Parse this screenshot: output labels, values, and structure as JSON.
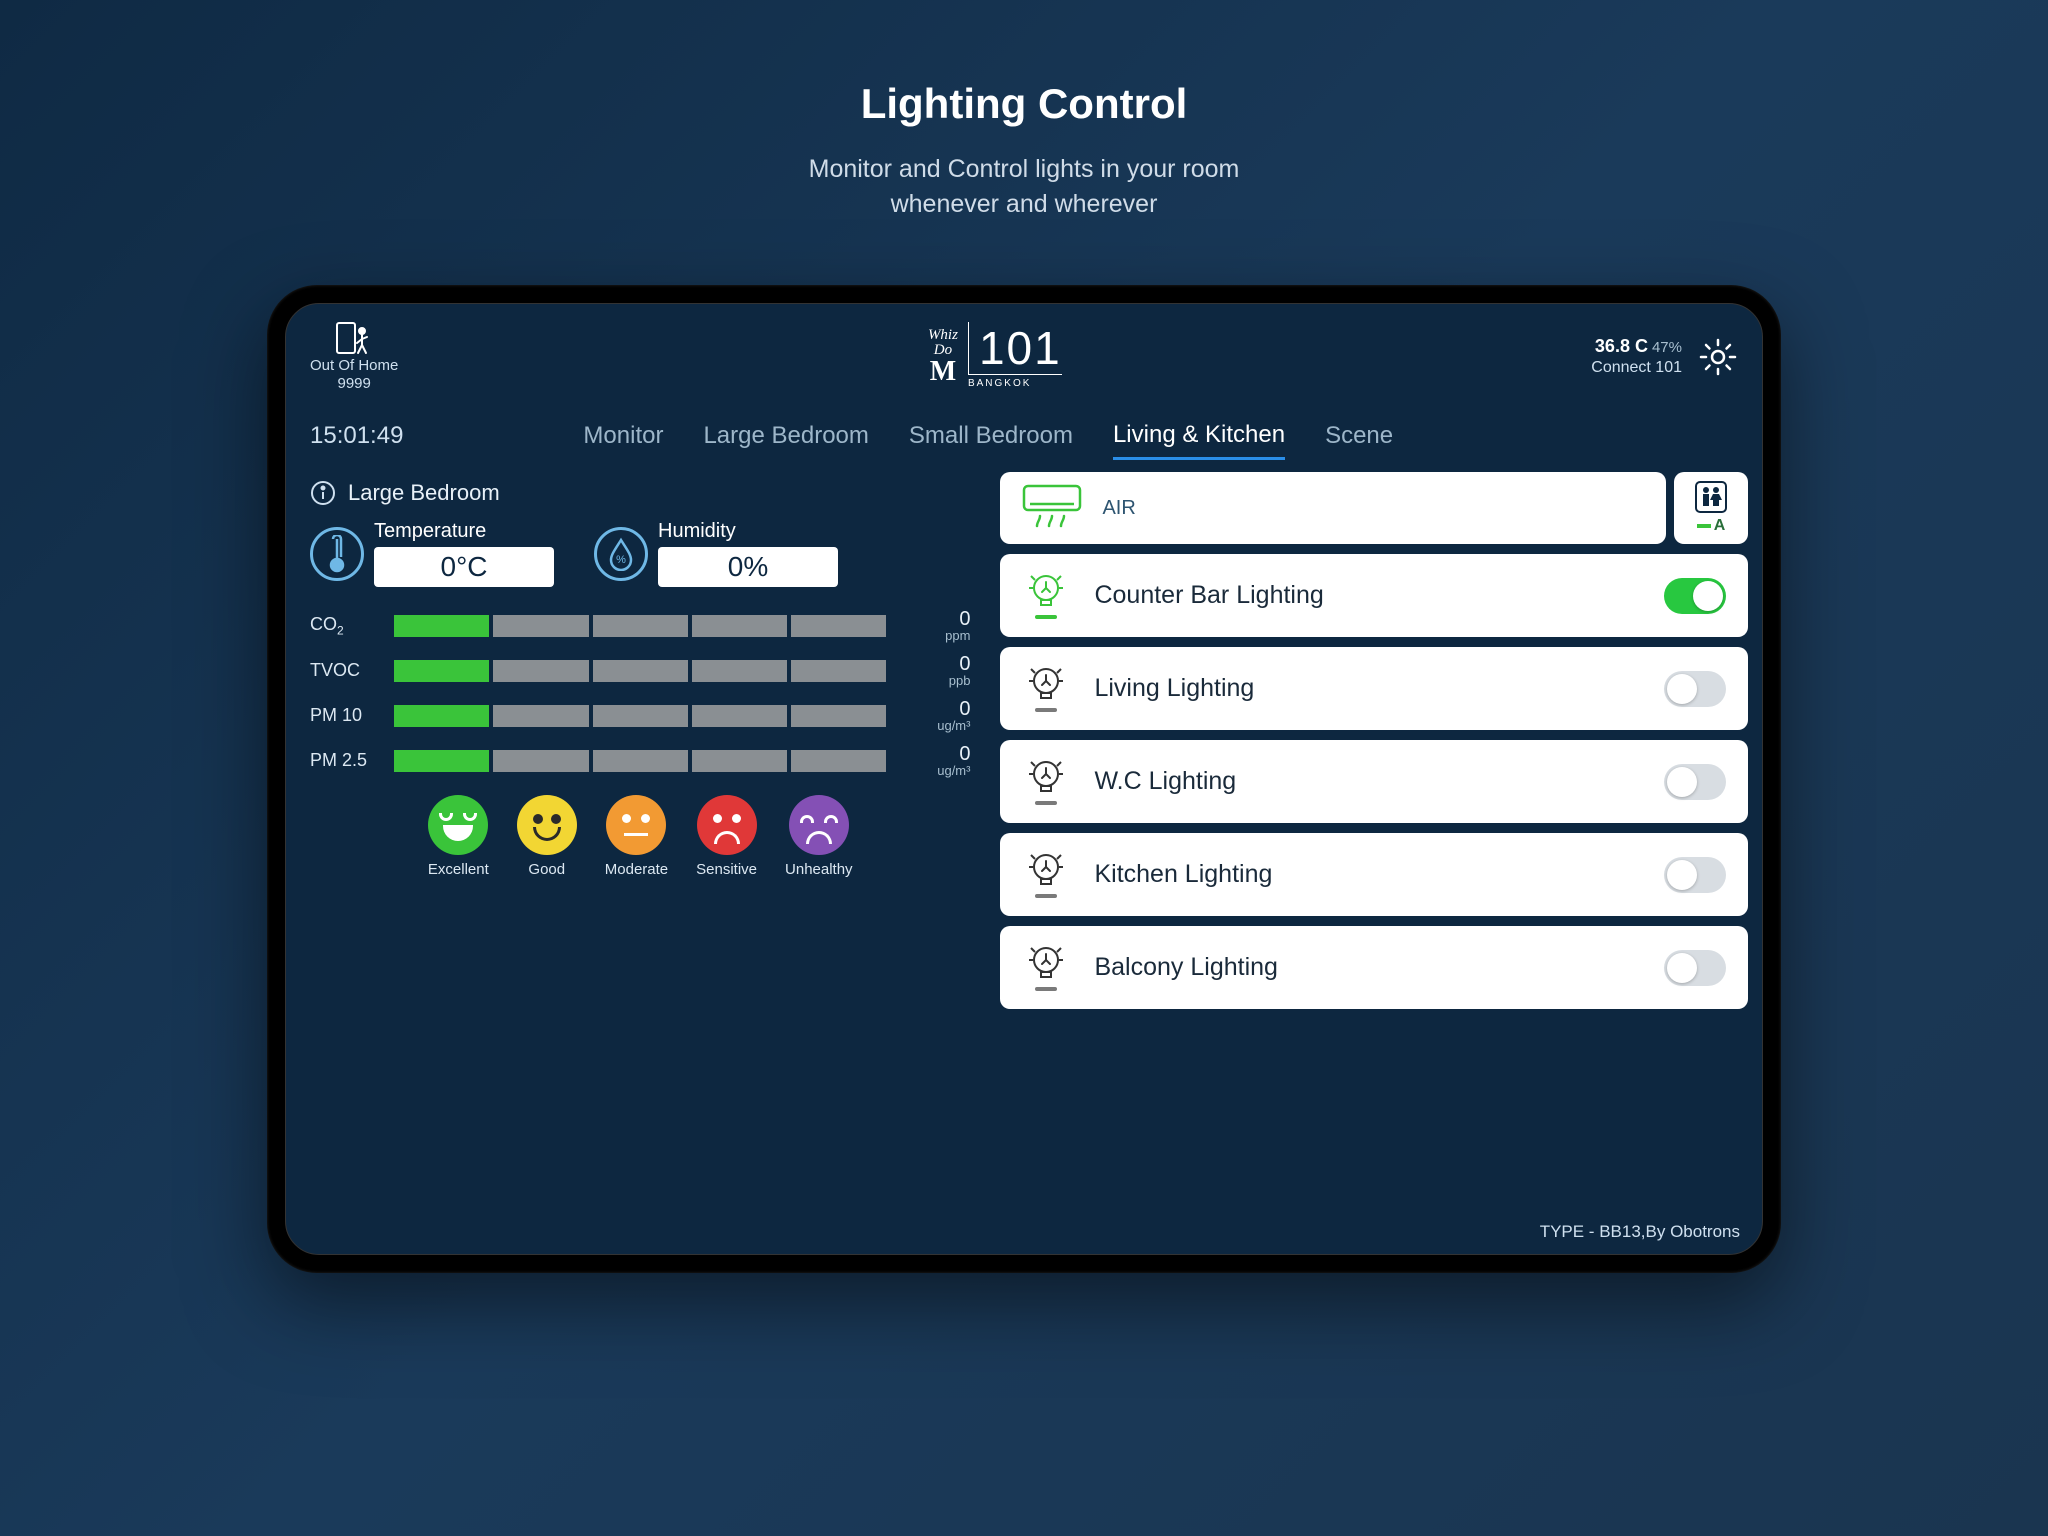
{
  "page": {
    "title": "Lighting Control",
    "subtitle_line1": "Monitor and Control lights in your room",
    "subtitle_line2": "whenever and wherever"
  },
  "header": {
    "home_label": "Out Of Home",
    "home_code": "9999",
    "brand_top": "Whiz",
    "brand_mid": "Do",
    "brand_big": "M",
    "brand_num": "101",
    "brand_sub": "BANGKOK",
    "temp": "36.8 C",
    "battery": "47%",
    "connection": "Connect 101"
  },
  "nav": {
    "clock": "15:01:49",
    "tabs": [
      "Monitor",
      "Large Bedroom",
      "Small Bedroom",
      "Living & Kitchen",
      "Scene"
    ],
    "active": 3
  },
  "room": {
    "name": "Large Bedroom",
    "temperature_label": "Temperature",
    "temperature_value": "0°C",
    "humidity_label": "Humidity",
    "humidity_value": "0%"
  },
  "quality": [
    {
      "label": "CO",
      "sub": "2",
      "value": "0",
      "unit": "ppm",
      "fill": 1
    },
    {
      "label": "TVOC",
      "sub": "",
      "value": "0",
      "unit": "ppb",
      "fill": 1
    },
    {
      "label": "PM 10",
      "sub": "",
      "value": "0",
      "unit": "ug/m³",
      "fill": 1
    },
    {
      "label": "PM 2.5",
      "sub": "",
      "value": "0",
      "unit": "ug/m³",
      "fill": 1
    }
  ],
  "legend": [
    "Excellent",
    "Good",
    "Moderate",
    "Sensitive",
    "Unhealthy"
  ],
  "air": {
    "label": "AIR",
    "mode": "A"
  },
  "lights": [
    {
      "name": "Counter Bar Lighting",
      "on": true
    },
    {
      "name": "Living Lighting",
      "on": false
    },
    {
      "name": "W.C Lighting",
      "on": false
    },
    {
      "name": "Kitchen Lighting",
      "on": false
    },
    {
      "name": "Balcony Lighting",
      "on": false
    }
  ],
  "footer": "TYPE - BB13,By Obotrons"
}
